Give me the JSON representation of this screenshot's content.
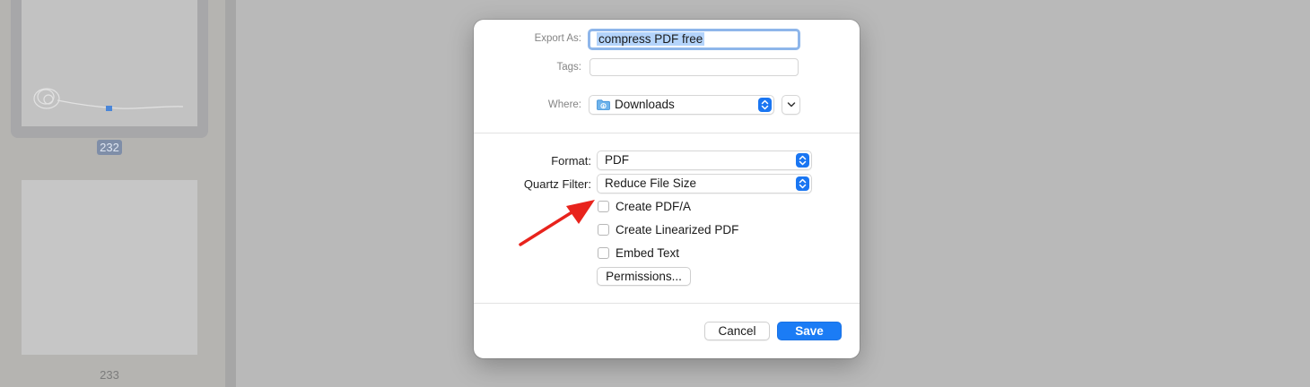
{
  "sidebar": {
    "current_page_badge": "232",
    "next_page_number": "233"
  },
  "dialog": {
    "export_as_label": "Export As:",
    "export_as_value": "compress PDF free",
    "tags_label": "Tags:",
    "tags_value": "",
    "where_label": "Where:",
    "where_value": "Downloads",
    "where_icon": "folder-downloads-icon",
    "format_label": "Format:",
    "format_value": "PDF",
    "quartz_label": "Quartz Filter:",
    "quartz_value": "Reduce File Size",
    "checkboxes": [
      {
        "label": "Create PDF/A",
        "checked": false
      },
      {
        "label": "Create Linearized PDF",
        "checked": false
      },
      {
        "label": "Embed Text",
        "checked": false
      }
    ],
    "permissions_label": "Permissions...",
    "cancel_label": "Cancel",
    "save_label": "Save"
  },
  "colors": {
    "accent": "#1b7cf5",
    "annotation_arrow": "#e8231c",
    "selection": "#b4d4fb"
  }
}
